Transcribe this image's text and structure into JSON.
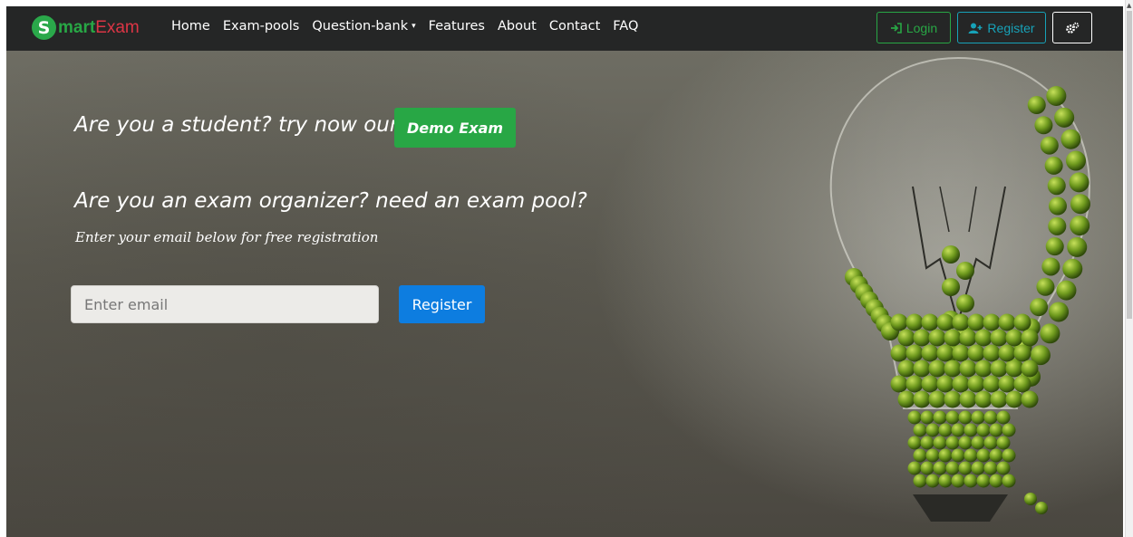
{
  "brand": {
    "s": "S",
    "mart": "mart",
    "exam": "Exam"
  },
  "nav": {
    "items": [
      {
        "label": "Home"
      },
      {
        "label": "Exam-pools"
      },
      {
        "label": "Question-bank",
        "caret": "▾"
      },
      {
        "label": "Features"
      },
      {
        "label": "About"
      },
      {
        "label": "Contact"
      },
      {
        "label": "FAQ"
      }
    ],
    "login_label": "Login",
    "register_label": "Register"
  },
  "hero": {
    "student_text": "Are you a student? try now our",
    "demo_label": "Demo Exam",
    "organizer_text": "Are you an exam organizer? need an exam pool?",
    "sub_text": "Enter your email below for free registration",
    "email_placeholder": "Enter email",
    "register_label": "Register"
  },
  "colors": {
    "navbar": "#252626",
    "success": "#28a745",
    "info": "#17a2b8",
    "primary": "#0d7de0",
    "brand_red": "#dc3545"
  },
  "icons": [
    "sign-in-icon",
    "user-plus-icon",
    "cogs-icon"
  ]
}
